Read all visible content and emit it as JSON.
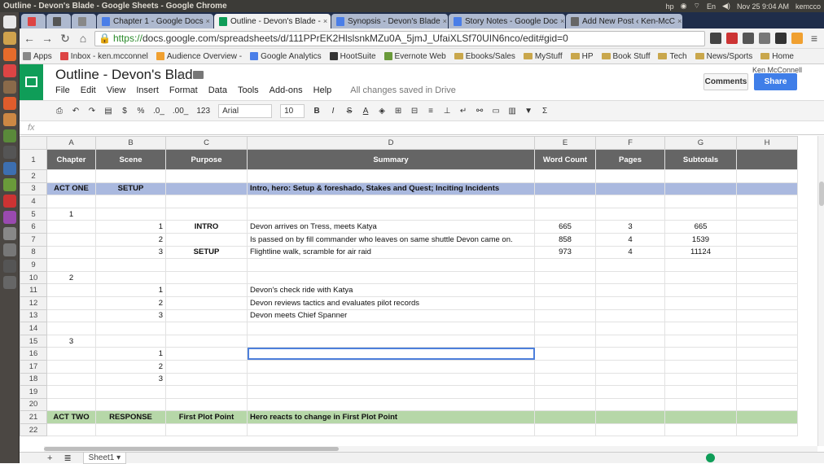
{
  "os": {
    "window_title": "Outline - Devon's Blade - Google Sheets - Google Chrome",
    "clock": "Nov 25  9:04 AM",
    "user": "kemcco",
    "lang": "En"
  },
  "tabs": [
    {
      "label": "",
      "color": "#d44"
    },
    {
      "label": "",
      "color": "#555"
    },
    {
      "label": "",
      "color": "#888"
    },
    {
      "label": "Chapter 1 - Google Docs",
      "color": "#4a7ee8"
    },
    {
      "label": "Outline - Devon's Blade -",
      "color": "#0f9d58",
      "active": true
    },
    {
      "label": "Synopsis - Devon's Blade",
      "color": "#4a7ee8"
    },
    {
      "label": "Story Notes - Google Doc",
      "color": "#4a7ee8"
    },
    {
      "label": "Add New Post ‹ Ken-McC",
      "color": "#666"
    }
  ],
  "url": {
    "prefix": "https://",
    "rest": "docs.google.com/spreadsheets/d/111PPrEK2HlslsnkMZu0A_5jmJ_UfaiXLSf70UIN6nco/edit#gid=0"
  },
  "bookmarks": [
    {
      "label": "Apps",
      "type": "apps"
    },
    {
      "label": "Inbox - ken.mcconnel",
      "type": "mail"
    },
    {
      "label": "Audience Overview -",
      "type": "ga"
    },
    {
      "label": "Google Analytics",
      "type": "g"
    },
    {
      "label": "HootSuite",
      "type": "hs"
    },
    {
      "label": "Evernote Web",
      "type": "ev"
    },
    {
      "label": "Ebooks/Sales",
      "type": "folder"
    },
    {
      "label": "MyStuff",
      "type": "folder"
    },
    {
      "label": "HP",
      "type": "folder"
    },
    {
      "label": "Book Stuff",
      "type": "folder"
    },
    {
      "label": "Tech",
      "type": "folder"
    },
    {
      "label": "News/Sports",
      "type": "folder"
    },
    {
      "label": "Home",
      "type": "folder"
    }
  ],
  "doc": {
    "title": "Outline - Devon's Blade",
    "user": "Ken McConnell",
    "comments": "Comments",
    "share": "Share",
    "saved": "All changes saved in Drive"
  },
  "menu": [
    "File",
    "Edit",
    "View",
    "Insert",
    "Format",
    "Data",
    "Tools",
    "Add-ons",
    "Help"
  ],
  "toolbar": {
    "currency": "$",
    "percent": "%",
    "dec_less": ".0_",
    "dec_more": ".00_",
    "format": "123",
    "font": "Arial",
    "size": "10",
    "bold": "B",
    "italic": "I",
    "strike": "S",
    "color": "A",
    "sum": "Σ"
  },
  "fx_label": "fx",
  "columns": [
    "",
    "A",
    "B",
    "C",
    "D",
    "E",
    "F",
    "G",
    "H"
  ],
  "header_row": {
    "num": "1",
    "cells": [
      "Chapter",
      "Scene",
      "Purpose",
      "Summary",
      "Word Count",
      "Pages",
      "Subtotals",
      ""
    ]
  },
  "rows": [
    {
      "num": "2",
      "cells": [
        "",
        "",
        "",
        "",
        "",
        "",
        "",
        ""
      ]
    },
    {
      "num": "3",
      "style": "act1",
      "cells": [
        "ACT ONE",
        "SETUP",
        "",
        "Intro, hero: Setup & foreshado, Stakes and Quest; Inciting Incidents",
        "",
        "",
        "",
        ""
      ]
    },
    {
      "num": "4",
      "cells": [
        "",
        "",
        "",
        "",
        "",
        "",
        "",
        ""
      ]
    },
    {
      "num": "5",
      "cells": [
        "1",
        "",
        "",
        "",
        "",
        "",
        "",
        ""
      ]
    },
    {
      "num": "6",
      "cells": [
        "",
        "1",
        "INTRO",
        "Devon arrives on Tress, meets Katya",
        "665",
        "3",
        "665",
        ""
      ]
    },
    {
      "num": "7",
      "cells": [
        "",
        "2",
        "",
        "Is passed on by fill commander who leaves on same shuttle Devon came on.",
        "858",
        "4",
        "1539",
        ""
      ]
    },
    {
      "num": "8",
      "cells": [
        "",
        "3",
        "SETUP",
        "Flightline walk, scramble for air raid",
        "973",
        "4",
        "11124",
        ""
      ]
    },
    {
      "num": "9",
      "cells": [
        "",
        "",
        "",
        "",
        "",
        "",
        "",
        ""
      ]
    },
    {
      "num": "10",
      "cells": [
        "2",
        "",
        "",
        "",
        "",
        "",
        "",
        ""
      ]
    },
    {
      "num": "11",
      "cells": [
        "",
        "1",
        "",
        "Devon's check ride with Katya",
        "",
        "",
        "",
        ""
      ]
    },
    {
      "num": "12",
      "cells": [
        "",
        "2",
        "",
        "Devon reviews tactics and evaluates pilot records",
        "",
        "",
        "",
        ""
      ]
    },
    {
      "num": "13",
      "cells": [
        "",
        "3",
        "",
        "Devon meets Chief Spanner",
        "",
        "",
        "",
        ""
      ]
    },
    {
      "num": "14",
      "cells": [
        "",
        "",
        "",
        "",
        "",
        "",
        "",
        ""
      ]
    },
    {
      "num": "15",
      "cells": [
        "3",
        "",
        "",
        "",
        "",
        "",
        "",
        ""
      ]
    },
    {
      "num": "16",
      "cells": [
        "",
        "1",
        "",
        "",
        "",
        "",
        "",
        ""
      ]
    },
    {
      "num": "17",
      "cells": [
        "",
        "2",
        "",
        "",
        "",
        "",
        "",
        ""
      ]
    },
    {
      "num": "18",
      "cells": [
        "",
        "3",
        "",
        "",
        "",
        "",
        "",
        ""
      ]
    },
    {
      "num": "19",
      "cells": [
        "",
        "",
        "",
        "",
        "",
        "",
        "",
        ""
      ]
    },
    {
      "num": "20",
      "cells": [
        "",
        "",
        "",
        "",
        "",
        "",
        "",
        ""
      ]
    },
    {
      "num": "21",
      "style": "act2",
      "cells": [
        "ACT TWO",
        "RESPONSE",
        "First Plot Point",
        "Hero reacts to change in First Plot Point",
        "",
        "",
        "",
        ""
      ]
    },
    {
      "num": "22",
      "cells": [
        "",
        "",
        "",
        "",
        "",
        "",
        "",
        ""
      ]
    }
  ],
  "sheet_tab": "Sheet1"
}
